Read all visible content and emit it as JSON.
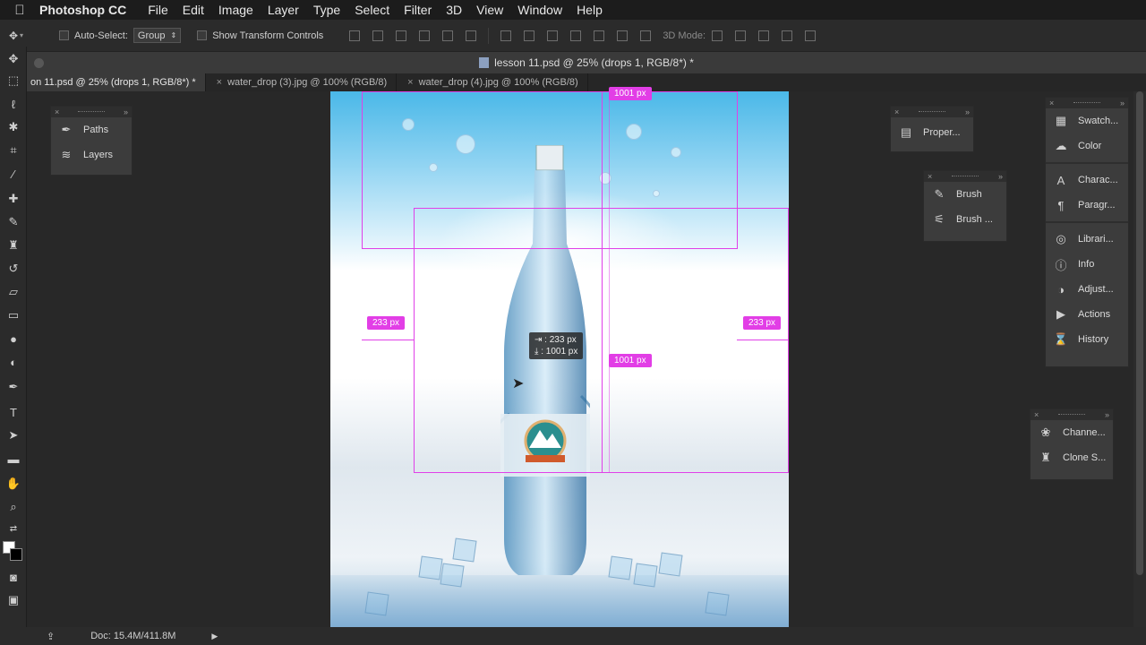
{
  "menubar": {
    "app_name": "Photoshop CC",
    "items": [
      "File",
      "Edit",
      "Image",
      "Layer",
      "Type",
      "Select",
      "Filter",
      "3D",
      "View",
      "Window",
      "Help"
    ]
  },
  "options": {
    "auto_select_label": "Auto-Select:",
    "auto_select_value": "Group",
    "show_transform_label": "Show Transform Controls",
    "mode_3d_label": "3D Mode:"
  },
  "document": {
    "title": "lesson 11.psd @ 25% (drops 1, RGB/8*) *",
    "tabs": [
      {
        "label": "on 11.psd @ 25% (drops 1, RGB/8*) *",
        "active": true
      },
      {
        "label": "water_drop (3).jpg @ 100% (RGB/8)",
        "active": false
      },
      {
        "label": "water_drop (4).jpg @ 100% (RGB/8)",
        "active": false
      }
    ]
  },
  "measurements": {
    "top_height": "1001 px",
    "mid_height": "1001 px",
    "left_width": "233 px",
    "right_width": "233 px",
    "tooltip_w": "233 px",
    "tooltip_h": "1001 px"
  },
  "panels": {
    "left": [
      {
        "icon": "paths-icon",
        "label": "Paths"
      },
      {
        "icon": "layers-icon",
        "label": "Layers"
      }
    ],
    "properties": [
      {
        "icon": "properties-icon",
        "label": "Proper..."
      }
    ],
    "brush": [
      {
        "icon": "brush-icon",
        "label": "Brush"
      },
      {
        "icon": "brush-presets-icon",
        "label": "Brush ..."
      }
    ],
    "right": [
      {
        "icon": "swatches-icon",
        "label": "Swatch..."
      },
      {
        "icon": "color-icon",
        "label": "Color"
      },
      {
        "icon": "character-icon",
        "label": "Charac..."
      },
      {
        "icon": "paragraph-icon",
        "label": "Paragr..."
      },
      {
        "icon": "libraries-icon",
        "label": "Librari..."
      },
      {
        "icon": "info-icon",
        "label": "Info"
      },
      {
        "icon": "adjustments-icon",
        "label": "Adjust..."
      },
      {
        "icon": "actions-icon",
        "label": "Actions"
      },
      {
        "icon": "history-icon",
        "label": "History"
      }
    ],
    "channels": [
      {
        "icon": "channels-icon",
        "label": "Channe..."
      },
      {
        "icon": "clone-source-icon",
        "label": "Clone S..."
      }
    ]
  },
  "status": {
    "doc_size": "Doc: 15.4M/411.8M"
  }
}
